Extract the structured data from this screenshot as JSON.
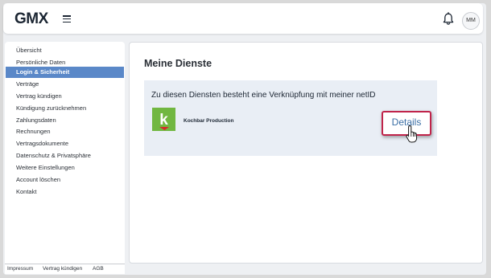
{
  "header": {
    "logo": "GMX",
    "avatar_initials": "MM",
    "icons": {
      "menu": "hamburger-menu-icon",
      "bell": "bell-icon"
    }
  },
  "sidebar": {
    "items": [
      {
        "label": "Übersicht",
        "active": false
      },
      {
        "label": "Persönliche Daten",
        "active": false
      },
      {
        "label": "Login & Sicherheit",
        "active": true
      },
      {
        "label": "Verträge",
        "active": false
      },
      {
        "label": "Vertrag kündigen",
        "active": false
      },
      {
        "label": "Kündigung zurücknehmen",
        "active": false
      },
      {
        "label": "Zahlungsdaten",
        "active": false
      },
      {
        "label": "Rechnungen",
        "active": false
      },
      {
        "label": "Vertragsdokumente",
        "active": false
      },
      {
        "label": "Datenschutz & Privatsphäre",
        "active": false
      },
      {
        "label": "Weitere Einstellungen",
        "active": false
      },
      {
        "label": "Account löschen",
        "active": false
      },
      {
        "label": "Kontakt",
        "active": false
      }
    ],
    "footer": [
      "Impressum",
      "Vertrag kündigen",
      "AGB"
    ]
  },
  "main": {
    "title": "Meine Dienste",
    "intro": "Zu diesen Diensten besteht eine Verknüpfung mit meiner netID",
    "service": {
      "logo_letter": "k",
      "name": "Kochbar Production",
      "button_label": "Details"
    }
  },
  "colors": {
    "active_nav": "#5a88c8",
    "highlight_border": "#c0244a",
    "link_blue": "#3a6ea5",
    "box_bg": "#e9eef5",
    "kochbar_green": "#71b741",
    "kochbar_red": "#d62a2a"
  }
}
